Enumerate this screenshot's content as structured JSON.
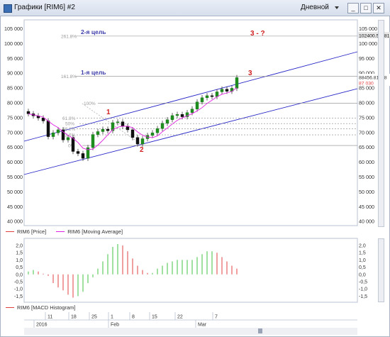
{
  "window": {
    "title": "Графики [RIM6] #2",
    "period": "Дневной",
    "buttons": [
      "_",
      "□",
      "✕"
    ]
  },
  "price_chart": {
    "yaxis_left": [
      "105 000",
      "100 000",
      "95 000",
      "90 000",
      "85 000",
      "80 000",
      "75 000",
      "70 000",
      "65 000",
      "60 000",
      "55 000",
      "50 000",
      "45 000",
      "40 000"
    ],
    "yaxis_right": [
      "105 000",
      "100 000",
      "95 000",
      "90 000",
      "85 000",
      "80 000",
      "75 000",
      "70 000",
      "65 000",
      "60 000",
      "55 000",
      "50 000",
      "45 000",
      "40 000"
    ],
    "price_labels": {
      "target2": "102400.54481",
      "last_price": "88456.81918",
      "ma_value": "87 030"
    },
    "fib_labels": [
      "261.8%",
      "161.8%",
      "100%",
      "61.8%",
      "50%",
      "38.2%",
      "23.6%",
      "0%"
    ],
    "annotations": {
      "target2": "2-я цель",
      "target1": "1-я цель",
      "wave1": "1",
      "wave2": "2",
      "wave3": "3",
      "wave3_q": "3 - ?"
    },
    "colors": {
      "channel": "#2626c8",
      "annotation_blue": "#3c3caa",
      "annotation_red": "#d02020",
      "up_candle": "#1e8f1e",
      "down_candle": "#111111",
      "ma": "#e020e0"
    }
  },
  "legend_main": [
    {
      "label": "RIM6 [Price]",
      "color": "#e04040"
    },
    {
      "label": "RIM6 [Moving Average]",
      "color": "#e020e0"
    }
  ],
  "macd_chart": {
    "yaxis": [
      "2,0",
      "1,5",
      "1,0",
      "0,5",
      "0,0",
      "-0,5",
      "-1,0",
      "-1,5"
    ],
    "legend": {
      "label": "RIM6 [MACD Histogram]",
      "color": "#e04040"
    }
  },
  "time_axis": {
    "days": [
      "11",
      "18",
      "25",
      "1",
      "8",
      "15",
      "22",
      "7"
    ],
    "months": [
      "2016",
      "Feb",
      "Mar"
    ]
  }
}
